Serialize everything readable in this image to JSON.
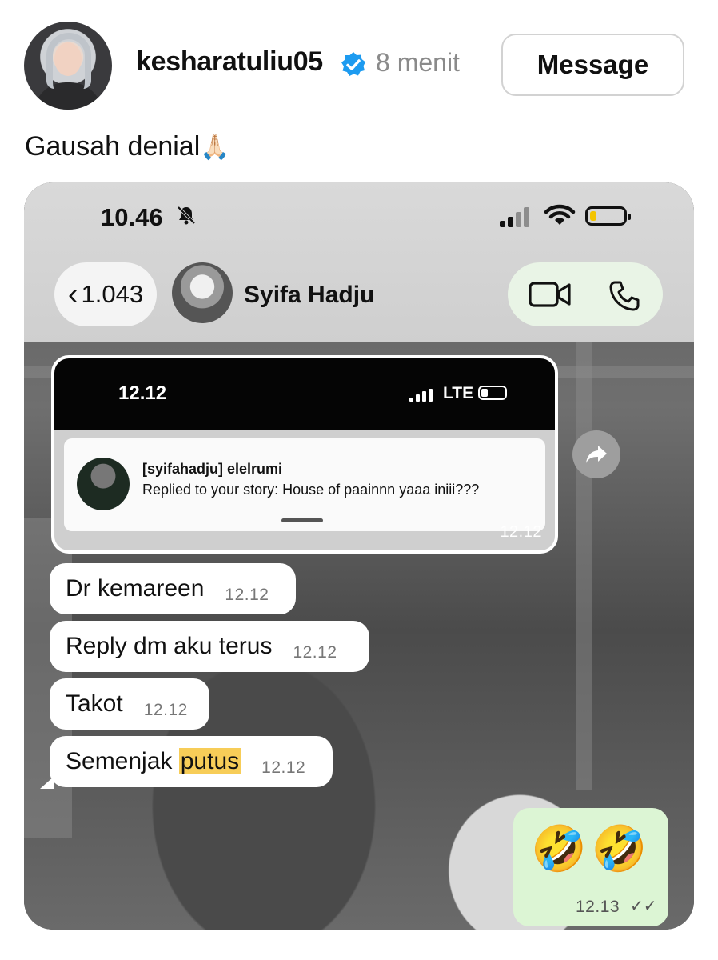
{
  "post": {
    "username": "kesharatuliu05",
    "time": "8 menit",
    "message_button": "Message",
    "caption": "Gausah denial",
    "caption_emoji": "🙏🏻"
  },
  "phone": {
    "status_time": "10.46",
    "back_count": "1.043",
    "contact_name": "Syifa Hadju",
    "quoted_screenshot": {
      "time": "12.12",
      "network": "LTE",
      "notification_title": "[syifahadju] elelrumi",
      "notification_body": "Replied to your story: House of paainnn yaaa iniii???",
      "message_time": "12.12"
    },
    "messages": [
      {
        "text": "Dr kemareen",
        "time": "12.12"
      },
      {
        "text": "Reply dm aku terus",
        "time": "12.12"
      },
      {
        "text": "Takot",
        "time": "12.12"
      },
      {
        "text_before": "Semenjak ",
        "text_highlight": "putus",
        "time": "12.12"
      }
    ],
    "outgoing": {
      "emoji": "🤣🤣",
      "time": "12.13"
    }
  },
  "colors": {
    "verified_blue": "#1d9bf0",
    "highlight": "#f7cd58",
    "outgoing_bubble": "#dcf5d4",
    "battery_yellow": "#f3c400"
  },
  "icons": [
    "verified-badge-icon",
    "bell-muted-icon",
    "signal-icon",
    "wifi-icon",
    "battery-icon",
    "chevron-left-icon",
    "video-call-icon",
    "phone-icon",
    "forward-icon",
    "double-check-icon"
  ]
}
